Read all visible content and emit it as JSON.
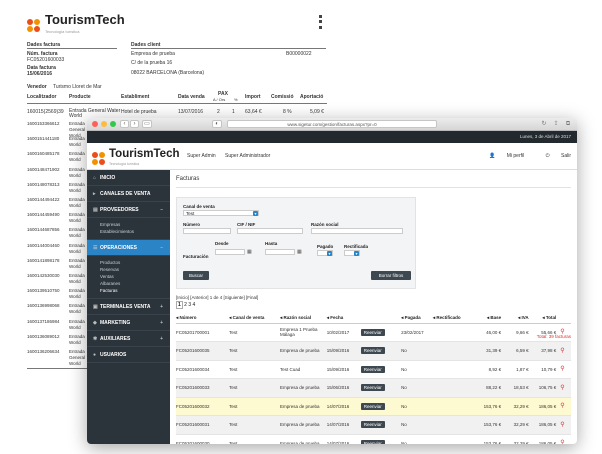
{
  "doc": {
    "logo_text": "TourismTech",
    "logo_sub": "Tecnología turística",
    "section_invoice": "Dades factura",
    "section_client": "Dades client",
    "invoice_num_label": "Núm. factura",
    "invoice_num": "FC05201600033",
    "invoice_date_label": "Data factura",
    "invoice_date": "15/06/2016",
    "client_name": "Empresa de prueba",
    "client_address": "C/ de la prueba 16",
    "client_city": "08022 BARCELONA (Barcelona)",
    "client_code": "B00000022",
    "seller_label": "Venedor",
    "seller": "Turismo Lloret de Mar",
    "headers": [
      "Localitzador",
      "Producte",
      "Establiment",
      "Data venda",
      "PAX",
      "Import",
      "Comissió",
      "Aportació"
    ],
    "pax_sub": "A / Ors",
    "pct_sub": "%",
    "first_row": {
      "loc": "160015(2569)39",
      "prod": "Entrada General Water World",
      "est": "Hotel de prueba",
      "date": "13/07/2016",
      "pax_a": "2",
      "pax_b": "1",
      "import": "63,64 €",
      "com": "8 %",
      "apo": "5,09 €"
    },
    "rows": [
      {
        "loc": "1600153366612",
        "prod": "Entrada General World"
      },
      {
        "loc": "1600151441180",
        "prod": "Entrada World"
      },
      {
        "loc": "1600160485178",
        "prod": "Entrada World"
      },
      {
        "loc": "1600148471902",
        "prod": "Entrada World"
      },
      {
        "loc": "1600148078313",
        "prod": "Entrada World"
      },
      {
        "loc": "1600144494422",
        "prod": "Entrada World"
      },
      {
        "loc": "1600144459490",
        "prod": "Entrada World"
      },
      {
        "loc": "1600144687856",
        "prod": "Entrada World"
      },
      {
        "loc": "1600144004460",
        "prod": "Entrada World"
      },
      {
        "loc": "1600141898178",
        "prod": "Entrada World"
      },
      {
        "loc": "1600142530030",
        "prod": "Entrada World"
      },
      {
        "loc": "1600139510750",
        "prod": "Entrada World"
      },
      {
        "loc": "1600136998068",
        "prod": "Entrada World"
      },
      {
        "loc": "1600137186984",
        "prod": "Entrada World"
      },
      {
        "loc": "1600136089012",
        "prod": "Entrada World"
      },
      {
        "loc": "1600136206634",
        "prod": "Entrada General World"
      }
    ]
  },
  "browser": {
    "url": "www.sigetur.com/gestion/facturas.aspx?pr=0",
    "status_date": "Lunes, 3 de Abril de 2017"
  },
  "app": {
    "logo_text": "TourismTech",
    "logo_sub": "Tecnología turística",
    "user_role": "Super Admin",
    "user_name": "Super Administrador",
    "profile_label": "Mi perfil",
    "logout_label": "Salir",
    "sidebar": [
      {
        "label": "INICIO",
        "icon": "home-icon",
        "sign": ""
      },
      {
        "label": "CANALES DE VENTA",
        "icon": "channel-icon",
        "sign": ""
      },
      {
        "label": "PROVEEDORES",
        "icon": "document-icon",
        "sign": "–",
        "subs": [
          "Empresas",
          "Establecimientos"
        ]
      },
      {
        "label": "OPERACIONES",
        "icon": "operations-icon",
        "sign": "–",
        "active": true,
        "subs": [
          "Productos",
          "Reservas",
          "Ventas",
          "Albaranes",
          "Facturas"
        ]
      },
      {
        "label": "TERMINALES VENTA",
        "icon": "terminal-icon",
        "sign": "+"
      },
      {
        "label": "MARKETING",
        "icon": "megaphone-icon",
        "sign": "+"
      },
      {
        "label": "AUXILIARES",
        "icon": "gear-icon",
        "sign": "+"
      },
      {
        "label": "USUARIOS",
        "icon": "user-icon",
        "sign": ""
      }
    ],
    "page_title": "Facturas",
    "filters": {
      "canal_label": "Canal de venta",
      "canal_value": "Test",
      "numero_label": "Número",
      "cif_label": "CIF / NIF",
      "razon_label": "Razón social",
      "facturacion_label": "Facturación",
      "desde_label": "Desde",
      "hasta_label": "Hasta",
      "pagado_label": "Pagado",
      "rectificado_label": "Rectificada",
      "search_button": "Buscar",
      "clear_button": "Borrar filtros"
    },
    "pager_text": "[Inicio] [Anterior] 1 de 4 [Siguiente] [Final]",
    "pages": [
      "1",
      "2",
      "3",
      "4"
    ],
    "total_text": "Total: 39 facturas",
    "columns": [
      "Número",
      "Canal de venta",
      "Razón social",
      "Fecha",
      "",
      "Pagada",
      "Rectificado",
      "Base",
      "IVA",
      "Total"
    ],
    "reenviar_label": "Reenviar",
    "rows": [
      {
        "num": "FC05201700001",
        "canal": "Test",
        "razon": "Empresa 1 Prueba Málaga",
        "fecha": "10/02/2017",
        "pagada": "23/02/2017",
        "base": "46,00 €",
        "iva": "9,66 €",
        "total": "55,66 €"
      },
      {
        "num": "FC05201600035",
        "canal": "Test",
        "razon": "Empresa de prueba",
        "fecha": "15/09/2016",
        "pagada": "No",
        "base": "31,39 €",
        "iva": "6,59 €",
        "total": "37,98 €"
      },
      {
        "num": "FC05201600034",
        "canal": "Test",
        "razon": "Test Cuad",
        "fecha": "15/09/2016",
        "pagada": "No",
        "base": "8,92 €",
        "iva": "1,87 €",
        "total": "10,79 €"
      },
      {
        "num": "FC05201600033",
        "canal": "Test",
        "razon": "Empresa de prueba",
        "fecha": "15/06/2016",
        "pagada": "No",
        "base": "88,22 €",
        "iva": "18,53 €",
        "total": "106,75 €"
      },
      {
        "num": "FC05201600032",
        "canal": "Test",
        "razon": "Empresa de prueba",
        "fecha": "14/07/2016",
        "pagada": "No",
        "base": "153,76 €",
        "iva": "32,29 €",
        "total": "186,05 €"
      },
      {
        "num": "FC05201600031",
        "canal": "Test",
        "razon": "Empresa de prueba",
        "fecha": "14/07/2016",
        "pagada": "No",
        "base": "153,76 €",
        "iva": "32,29 €",
        "total": "186,05 €"
      },
      {
        "num": "FC05201600030",
        "canal": "Test",
        "razon": "Empresa de prueba",
        "fecha": "14/07/2016",
        "pagada": "No",
        "base": "153,76 €",
        "iva": "32,29 €",
        "total": "186,05 €"
      }
    ]
  },
  "colors": {
    "accent": "#2a84c6",
    "sidebar_bg": "#2c343b",
    "highlight_row": "#fdf9d0",
    "red": "#d9302c"
  }
}
